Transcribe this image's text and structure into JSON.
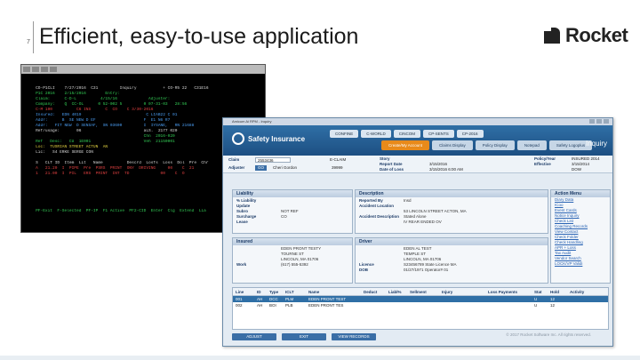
{
  "slide": {
    "number": "7",
    "title": "Efficient, easy-to-use application",
    "logo_text": "Rocket"
  },
  "terminal": {
    "lines": [
      {
        "text": "",
        "c": "g"
      },
      {
        "text": "",
        "c": "g"
      },
      {
        "text": "   CO-P1CLI    7/27/2016  C31         Inquiry           + CO-R5 22   C31E16",
        "c": "w"
      },
      {
        "text": "   P1C 2016    2/15/2016        Entry:",
        "c": "g"
      },
      {
        "text": "   Claim:      C-D-L          4/15/16             Adjuster:",
        "c": "g"
      },
      {
        "text": "   Company:    Q  CC-OL      0 52-002 5         0 07-31-03   28:56",
        "c": "g"
      },
      {
        "text": "   C-M 100          C6 INS      C  CO    C 3/30-2016",
        "c": "r"
      },
      {
        "text": "   Insured:   EDN 4019                           C LIAB22 C 01",
        "c": "b"
      },
      {
        "text": "   Addr:      B  SE NEW D EF                    F  E1 N6 R7",
        "c": "b"
      },
      {
        "text": "   Addr:   FIT NEW  D SENSAF,  SN 03600         I  IYSANE,   RN 21688",
        "c": "b"
      },
      {
        "text": "   Ref/usage:       06                          aLS.  2177 020",
        "c": "w"
      },
      {
        "text": "                                                Chn  2016-020",
        "c": "g"
      },
      {
        "text": "   Ref   Desc:   CU  1E001                      Veh  21150001",
        "c": "g"
      },
      {
        "text": "   Loc:  TUSRIAN STREET ACTUN  AN",
        "c": "y"
      },
      {
        "text": "   Lic:   S4 ERKE SERGE CON",
        "c": "w"
      },
      {
        "text": "",
        "c": "g"
      },
      {
        "text": "   S   CLT ID  Item  Lit   Name          Descrd  Losfs  Loss  Dol  Pre  Chr",
        "c": "w"
      },
      {
        "text": "   A   21.20  I  PIPE  Pre  PSRS  PRINT  ONY  DRIVING     00    C  21",
        "c": "r"
      },
      {
        "text": "   1   21.00  I  PIL   ERS  PRINT  INT  TD             00    C  O",
        "c": "r"
      },
      {
        "text": "",
        "c": "g"
      },
      {
        "text": "",
        "c": "g"
      },
      {
        "text": "",
        "c": "g"
      },
      {
        "text": "",
        "c": "g"
      },
      {
        "text": "",
        "c": "g"
      },
      {
        "text": "",
        "c": "g"
      },
      {
        "text": "   PF-Exit  F-Selected  PF-IP  F1 Active  PF2-CID  Enter  Clg  Extend  Lia",
        "c": "g"
      },
      {
        "text": "",
        "c": "g"
      },
      {
        "text": "",
        "c": "g"
      }
    ]
  },
  "app": {
    "window_title": "Amicum Ai  RPM - Inquiry",
    "brand": "Safety Insurance",
    "nav_tabs": [
      "CONFINE",
      "C-WORLD",
      "CINCOM",
      "CP-SENTS",
      "CP-2016"
    ],
    "sub_tabs": [
      "Create/My Account",
      "Claims Display",
      "Policy Display",
      "Notepad",
      "Safety Logoplus"
    ],
    "page_label": "Inquiry",
    "claim": {
      "claim_label": "Claim",
      "claim_value": "2553436",
      "eclaim": "E-CLAIM",
      "adjuster_label": "Adjuster",
      "go": "GO",
      "adjuster_name": "Cheri Gordon",
      "adjuster_code": "39999",
      "story_label": "Story",
      "report_label": "Report Date",
      "report_value": "3/15/2016",
      "loss_label": "Date of Loss",
      "loss_value": "3/15/2016 6:00 AM",
      "policy_year_label": "Policy/Year",
      "policy_year_value": "INSURED 2014",
      "effective_label": "Effective",
      "effective_value": "3/15/2014",
      "dol_value": "DOW"
    },
    "liability": {
      "head": "Liability",
      "rows": [
        {
          "k": "% Liability",
          "v": ""
        },
        {
          "k": "Update",
          "v": ""
        },
        {
          "k": "Subro",
          "v": "NOT REF"
        },
        {
          "k": "Surcharge",
          "v": "CO"
        },
        {
          "k": "Lease",
          "v": ""
        }
      ]
    },
    "description": {
      "head": "Description",
      "rows": [
        {
          "k": "Reported By",
          "v": "Insd"
        },
        {
          "k": "Accident Location",
          "v": ""
        },
        {
          "k": "",
          "v": "53 LINCOLN STREET ACTON, MA"
        },
        {
          "k": "Accident Description",
          "v": "Stated Alone"
        },
        {
          "k": "",
          "v": "IV REAR ENDED OV"
        }
      ]
    },
    "action_menu": {
      "head": "Action Menu",
      "items": [
        "Diary Data",
        "ICoo",
        "Event Cards",
        "Notice Inquiry",
        "Check List",
        "Coaching Records",
        "View Contact",
        "Check Folder",
        "Check Handling",
        "APR + Loss",
        "Tax Audit",
        "Vendor Search",
        "LOCK/VP Validi"
      ]
    },
    "insured": {
      "head": "Insured",
      "rows": [
        {
          "k": "",
          "v": "EDEN PRONT TESTY"
        },
        {
          "k": "",
          "v": "TOURNE ST"
        },
        {
          "k": "",
          "v": "LINCOLN, MA 01706"
        },
        {
          "k": "Work",
          "v": "(617) 555-5392"
        }
      ]
    },
    "driver": {
      "head": "Driver",
      "rows": [
        {
          "k": "",
          "v": "EDEN AL TEST"
        },
        {
          "k": "",
          "v": "TEMPLE ST"
        },
        {
          "k": "",
          "v": "LINCOLN, MA 01706"
        },
        {
          "k": "Licence",
          "v": "S23456789    State Licence  MA"
        },
        {
          "k": "DOB",
          "v": "01/27/1971   Operator#  01"
        }
      ]
    },
    "grid": {
      "headers": [
        "Line",
        "ID",
        "Type",
        "ICLT",
        "Name",
        "Deduct",
        "Liabl%",
        "Sellment",
        "Injury",
        "Loss Payments",
        "Stat",
        "Hold",
        "Activity"
      ],
      "rows": [
        [
          "001",
          "AH",
          "DCC",
          "PLM",
          "EDEN PRONT TEST",
          "",
          "",
          "",
          "",
          "",
          "U",
          "12",
          ""
        ],
        [
          "002",
          "AH",
          "BOI",
          "PLB",
          "EDEN PRONT TES",
          "",
          "",
          "",
          "",
          "",
          "U",
          "12",
          ""
        ]
      ],
      "activity_header": "Activity",
      "activity_values": [
        "5",
        "1"
      ]
    },
    "buttons": [
      "ADJUST",
      "EXIT",
      "VIEW RECORDS"
    ],
    "copyright": "© 2017 Rocket Software Inc. All rights reserved."
  }
}
